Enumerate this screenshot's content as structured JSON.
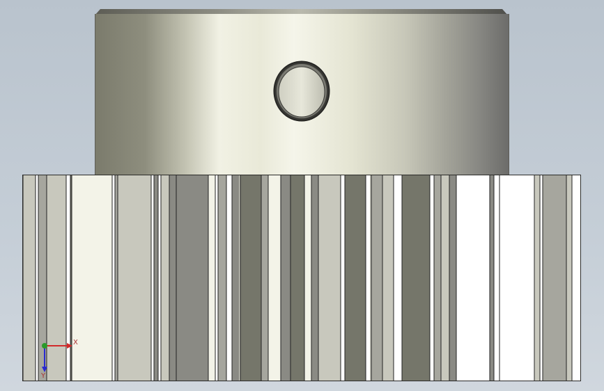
{
  "viewport": {
    "background_top": "#b9c3cd",
    "background_bottom": "#d0d7de"
  },
  "model": {
    "parts": [
      "hub",
      "set-screw-hole",
      "gear-teeth"
    ],
    "hub_color": "#e9e9d8",
    "gear_tooth_colors": [
      "#f3f3e8",
      "#8a8a84",
      "#75766a",
      "#c8c8bd",
      "#ffffff",
      "#a6a69e"
    ]
  },
  "triad": {
    "x_label": "X",
    "y_label": "Y",
    "x_color": "#d12a2a",
    "y_color": "#2a9a2a",
    "z_color": "#2a2ad1"
  }
}
